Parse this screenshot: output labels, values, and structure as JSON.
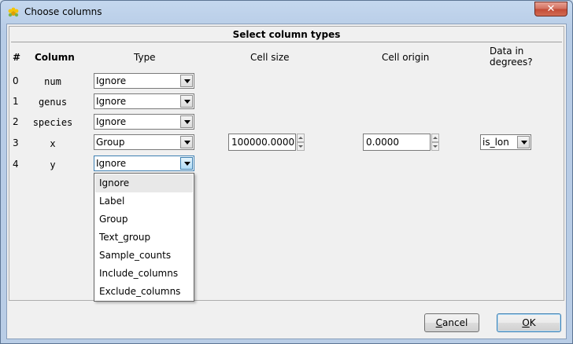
{
  "window": {
    "title": "Choose columns",
    "close_glyph": "✕",
    "app_icon": "app-flower-icon"
  },
  "panel": {
    "title": "Select column types"
  },
  "headers": {
    "num": "#",
    "column": "Column",
    "type": "Type",
    "cell_size": "Cell size",
    "cell_origin": "Cell origin",
    "degrees_line1": "Data in",
    "degrees_line2": "degrees?"
  },
  "rows": [
    {
      "index": "0",
      "column": "num",
      "type": "Ignore"
    },
    {
      "index": "1",
      "column": "genus",
      "type": "Ignore"
    },
    {
      "index": "2",
      "column": "species",
      "type": "Ignore"
    },
    {
      "index": "3",
      "column": "x",
      "type": "Group",
      "cell_size": "100000.0000",
      "cell_origin": "0.0000",
      "degrees": "is_lon"
    },
    {
      "index": "4",
      "column": "y",
      "type": "Ignore"
    }
  ],
  "dropdown": {
    "options": [
      "Ignore",
      "Label",
      "Group",
      "Text_group",
      "Sample_counts",
      "Include_columns",
      "Exclude_columns"
    ],
    "highlighted": "Ignore"
  },
  "buttons": {
    "cancel": "Cancel",
    "cancel_key": "C",
    "cancel_rest": "ancel",
    "ok": "OK",
    "ok_key": "O",
    "ok_rest": "K"
  }
}
